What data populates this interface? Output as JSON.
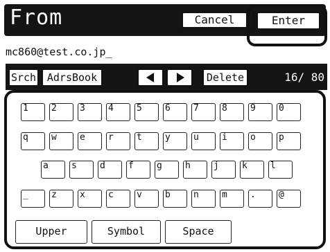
{
  "header": {
    "title": "From",
    "cancel_label": "Cancel",
    "enter_label": "Enter"
  },
  "address": {
    "value": "mc860@test.co.jp_"
  },
  "toolbar": {
    "search_label": "Srch",
    "address_book_label": "AdrsBook",
    "delete_label": "Delete",
    "count": "16/ 80"
  },
  "keyboard": {
    "row1": [
      "1",
      "2",
      "3",
      "4",
      "5",
      "6",
      "7",
      "8",
      "9",
      "0"
    ],
    "row2": [
      "q",
      "w",
      "e",
      "r",
      "t",
      "y",
      "u",
      "i",
      "o",
      "p"
    ],
    "row3": [
      "a",
      "s",
      "d",
      "f",
      "g",
      "h",
      "j",
      "k",
      "l"
    ],
    "row4": [
      "_",
      "z",
      "x",
      "c",
      "v",
      "b",
      "n",
      "m",
      ".",
      "@"
    ],
    "upper_label": "Upper",
    "symbol_label": "Symbol",
    "space_label": "Space"
  }
}
